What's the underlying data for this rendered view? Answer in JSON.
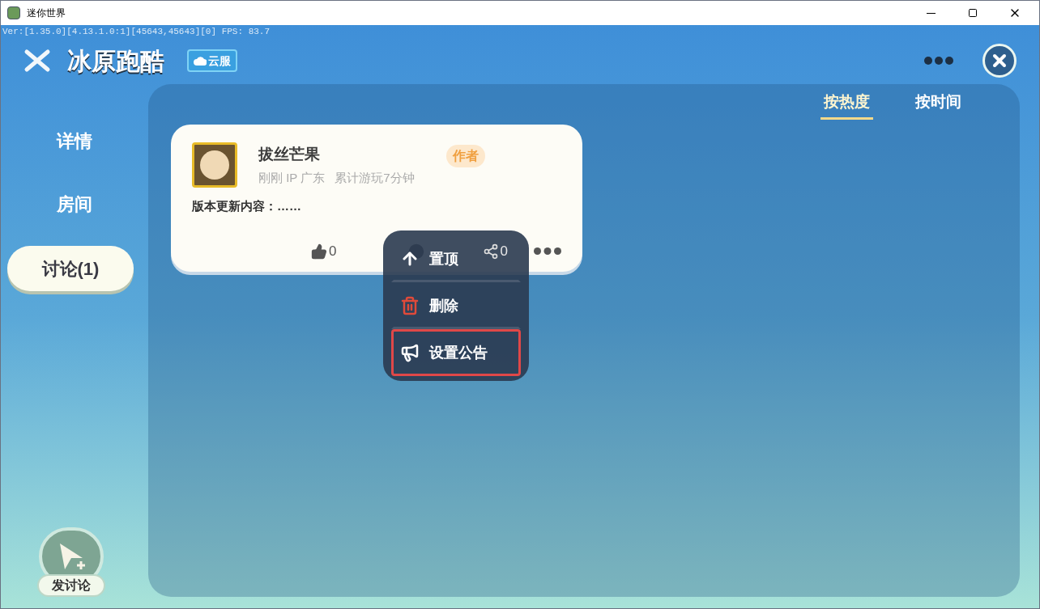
{
  "window": {
    "title": "迷你世界"
  },
  "debug": "Ver:[1.35.0][4.13.1.0:1][45643,45643][0] FPS: 83.7",
  "header": {
    "title": "冰原跑酷",
    "badge": "云服"
  },
  "nav": [
    {
      "label": "详情",
      "selected": false
    },
    {
      "label": "房间",
      "selected": false
    },
    {
      "label": "讨论(1)",
      "selected": true
    }
  ],
  "sort_tabs": [
    {
      "label": "按热度",
      "selected": true
    },
    {
      "label": "按时间",
      "selected": false
    }
  ],
  "post": {
    "author": "拔丝芒果",
    "tag": "作者",
    "meta": "刚刚 IP 广东",
    "playtime": "累计游玩7分钟",
    "content": "版本更新内容：……",
    "likes": "0",
    "shares": "0"
  },
  "menu": [
    {
      "kind": "pin",
      "label": "置顶",
      "highlighted": false
    },
    {
      "kind": "delete",
      "label": "删除",
      "highlighted": false
    },
    {
      "kind": "announce",
      "label": "设置公告",
      "highlighted": true
    }
  ],
  "compose": {
    "label": "发讨论"
  }
}
